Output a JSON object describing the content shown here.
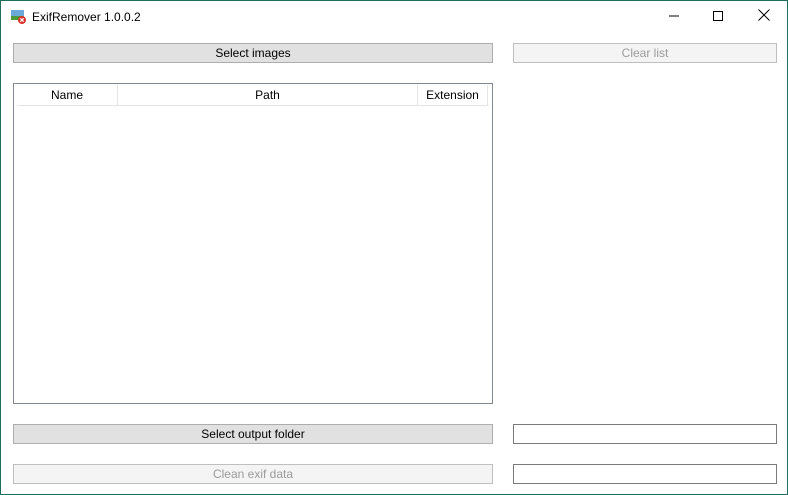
{
  "window": {
    "title": "ExifRemover 1.0.0.2",
    "controls": {
      "minimize": "minimize",
      "maximize": "maximize",
      "close": "close"
    }
  },
  "toolbar": {
    "select_images_label": "Select images",
    "clear_list_label": "Clear list",
    "clear_list_enabled": false
  },
  "list": {
    "columns": [
      "Name",
      "Path",
      "Extension"
    ],
    "rows": []
  },
  "output": {
    "select_output_folder_label": "Select output folder",
    "output_folder_value": "",
    "clean_exif_label": "Clean exif data",
    "clean_exif_enabled": false,
    "status_value": ""
  },
  "icons": {
    "app": "exif-remover-app-icon",
    "minimize": "minimize-icon",
    "maximize": "maximize-icon",
    "close": "close-icon"
  },
  "colors": {
    "button_bg": "#e1e1e1",
    "button_border": "#adadad",
    "disabled_text": "#9a9a9a",
    "window_border": "#1f6f5f"
  }
}
